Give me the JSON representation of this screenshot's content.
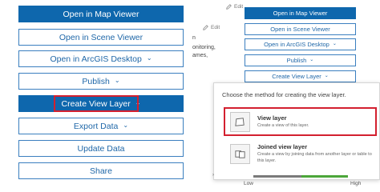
{
  "left_panel": {
    "open_map_viewer": "Open in Map Viewer",
    "open_scene_viewer": "Open in Scene Viewer",
    "open_arcgis_desktop": "Open in ArcGIS Desktop",
    "publish": "Publish",
    "create_view_layer": "Create View Layer",
    "export_data": "Export Data",
    "update_data": "Update Data",
    "share": "Share"
  },
  "middle": {
    "edit_label": "Edit",
    "edit_label_2": "Edit",
    "snippet_1": "n",
    "snippet_2": "onitoring,",
    "snippet_3": "ames,"
  },
  "right_panel": {
    "open_map_viewer": "Open in Map Viewer",
    "open_scene_viewer": "Open in Scene Viewer",
    "open_arcgis_desktop": "Open in ArcGIS Desktop",
    "publish": "Publish",
    "create_view_layer": "Create View Layer"
  },
  "popover": {
    "title": "Choose the method for creating the view layer.",
    "options": [
      {
        "name": "View layer",
        "description": "Create a view of this layer."
      },
      {
        "name": "Joined view layer",
        "description": "Create a view by joining data from another layer or table to this layer."
      }
    ]
  },
  "bottom": {
    "low_label": "Low",
    "high_label": "High"
  },
  "colors": {
    "primary": "#0e67ad",
    "highlight": "#d3202f",
    "bar_gray": "#7a7a7a",
    "bar_green": "#4ca63a"
  }
}
